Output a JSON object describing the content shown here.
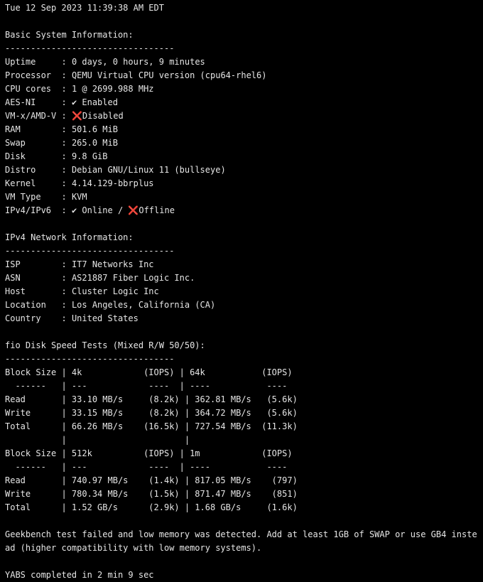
{
  "timestamp": "Tue 12 Sep 2023 11:39:38 AM EDT",
  "basic": {
    "title": "Basic System Information:",
    "divider": "---------------------------------",
    "rows": [
      {
        "key": "Uptime     ",
        "value": "0 days, 0 hours, 9 minutes"
      },
      {
        "key": "Processor  ",
        "value": "QEMU Virtual CPU version (cpu64-rhel6)"
      },
      {
        "key": "CPU cores  ",
        "value": "1 @ 2699.988 MHz"
      },
      {
        "key": "AES-NI     ",
        "value": "✔ Enabled"
      },
      {
        "key": "VM-x/AMD-V ",
        "value": "❌Disabled"
      },
      {
        "key": "RAM        ",
        "value": "501.6 MiB"
      },
      {
        "key": "Swap       ",
        "value": "265.0 MiB"
      },
      {
        "key": "Disk       ",
        "value": "9.8 GiB"
      },
      {
        "key": "Distro     ",
        "value": "Debian GNU/Linux 11 (bullseye)"
      },
      {
        "key": "Kernel     ",
        "value": "4.14.129-bbrplus"
      },
      {
        "key": "VM Type    ",
        "value": "KVM"
      },
      {
        "key": "IPv4/IPv6  ",
        "value": "✔ Online / ❌Offline"
      }
    ]
  },
  "network": {
    "title": "IPv4 Network Information:",
    "divider": "---------------------------------",
    "rows": [
      {
        "key": "ISP        ",
        "value": "IT7 Networks Inc"
      },
      {
        "key": "ASN        ",
        "value": "AS21887 Fiber Logic Inc."
      },
      {
        "key": "Host       ",
        "value": "Cluster Logic Inc"
      },
      {
        "key": "Location   ",
        "value": "Los Angeles, California (CA)"
      },
      {
        "key": "Country    ",
        "value": "United States"
      }
    ]
  },
  "fio": {
    "title": "fio Disk Speed Tests (Mixed R/W 50/50):",
    "divider": "---------------------------------",
    "table1": [
      "Block Size | 4k            (IOPS) | 64k           (IOPS)",
      "  ------   | ---            ----  | ----           ----",
      "Read       | 33.10 MB/s     (8.2k) | 362.81 MB/s   (5.6k)",
      "Write      | 33.15 MB/s     (8.2k) | 364.72 MB/s   (5.6k)",
      "Total      | 66.26 MB/s    (16.5k) | 727.54 MB/s  (11.3k)",
      "           |                       |"
    ],
    "table2": [
      "Block Size | 512k          (IOPS) | 1m            (IOPS)",
      "  ------   | ---            ----  | ----           ----",
      "Read       | 740.97 MB/s    (1.4k) | 817.05 MB/s    (797)",
      "Write      | 780.34 MB/s    (1.5k) | 871.47 MB/s    (851)",
      "Total      | 1.52 GB/s      (2.9k) | 1.68 GB/s     (1.6k)"
    ]
  },
  "geekbench_message": "Geekbench test failed and low memory was detected. Add at least 1GB of SWAP or use GB4 instead (higher compatibility with low memory systems).",
  "completion": "YABS completed in 2 min 9 sec"
}
